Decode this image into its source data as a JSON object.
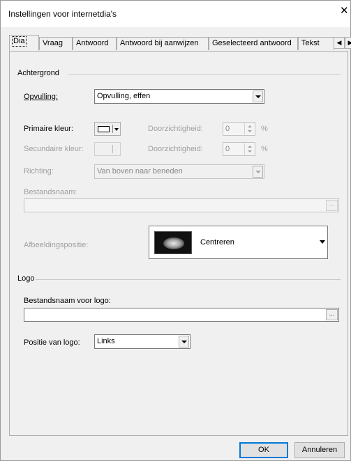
{
  "window": {
    "title": "Instellingen voor internetdia's"
  },
  "icons": {
    "close": "close-icon",
    "tab_left": "chevron-left-icon",
    "tab_right": "chevron-right-icon",
    "browse": "ellipsis-icon"
  },
  "tabs": [
    {
      "label": "Dia",
      "active": true
    },
    {
      "label": "Vraag"
    },
    {
      "label": "Antwoord"
    },
    {
      "label": "Antwoord bij aanwijzen"
    },
    {
      "label": "Geselecteerd antwoord"
    },
    {
      "label": "Tekst"
    }
  ],
  "background": {
    "group_label": "Achtergrond",
    "fill_label": "Opvulling:",
    "fill_value": "Opvulling, effen",
    "primary_color_label": "Primaire kleur:",
    "primary_color": "#ffffff",
    "transparency1_label": "Doorzichtigheid:",
    "transparency1_value": "0",
    "percent1": "%",
    "secondary_color_label": "Secundaire kleur:",
    "transparency2_label": "Doorzichtigheid:",
    "transparency2_value": "0",
    "percent2": "%",
    "direction_label": "Richting:",
    "direction_value": "Van boven naar beneden",
    "filename_label": "Bestandsnaam:",
    "filename_value": "",
    "browse_label": "...",
    "image_position_label": "Afbeeldingspositie:",
    "image_position_value": "Centreren"
  },
  "logo": {
    "group_label": "Logo",
    "filename_label": "Bestandsnaam voor logo:",
    "filename_value": "",
    "browse_label": "...",
    "position_label": "Positie van logo:",
    "position_value": "Links"
  },
  "footer": {
    "ok_label": "OK",
    "cancel_label": "Annuleren"
  }
}
